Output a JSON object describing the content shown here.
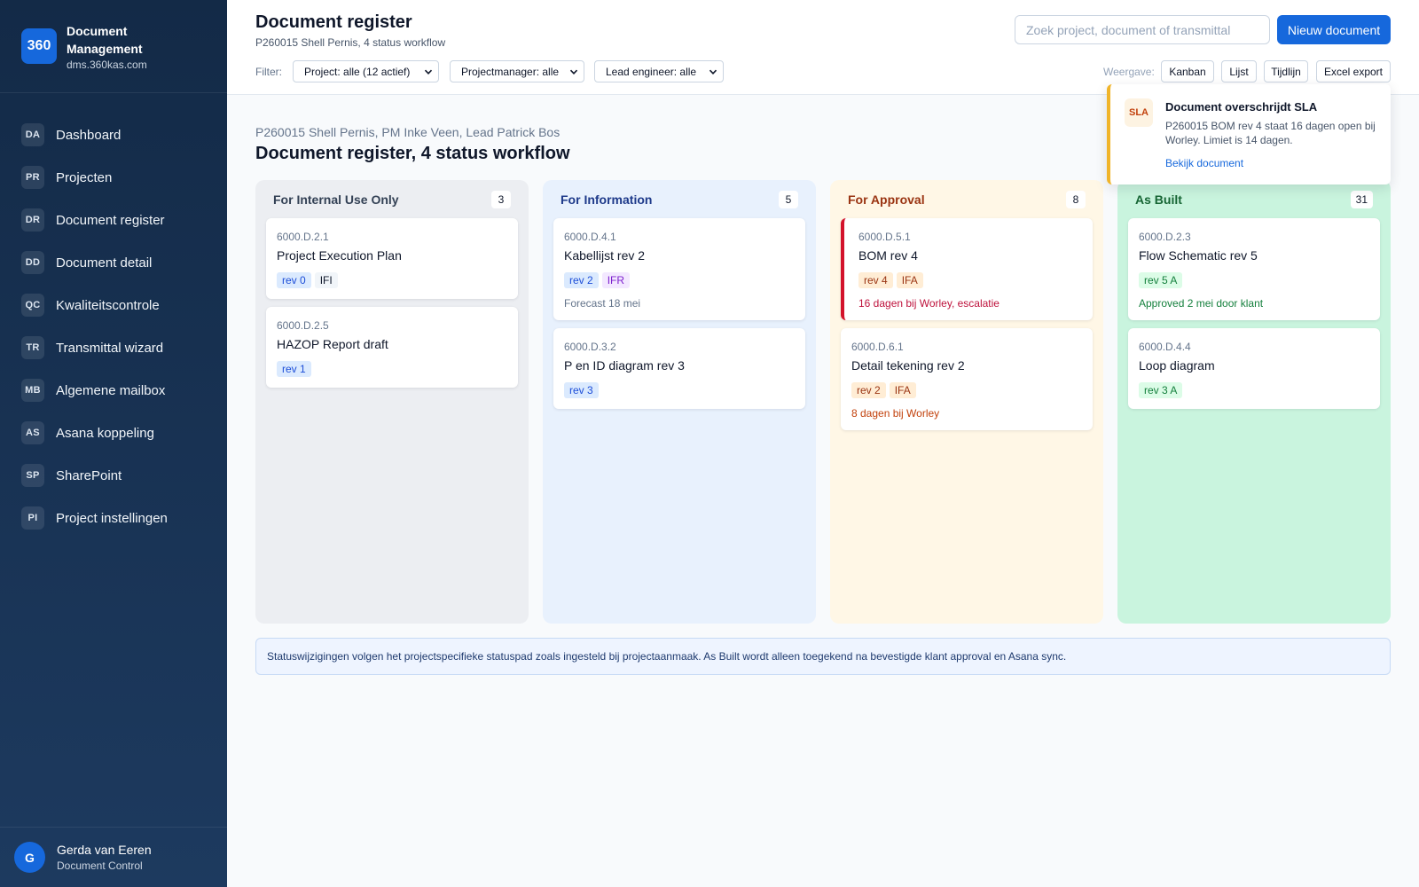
{
  "brand": {
    "logo": "360",
    "name": "Document Management",
    "url": "dms.360kas.com"
  },
  "nav": [
    {
      "abbr": "DA",
      "label": "Dashboard"
    },
    {
      "abbr": "PR",
      "label": "Projecten"
    },
    {
      "abbr": "DR",
      "label": "Document register"
    },
    {
      "abbr": "DD",
      "label": "Document detail"
    },
    {
      "abbr": "QC",
      "label": "Kwaliteitscontrole"
    },
    {
      "abbr": "TR",
      "label": "Transmittal wizard"
    },
    {
      "abbr": "MB",
      "label": "Algemene mailbox"
    },
    {
      "abbr": "AS",
      "label": "Asana koppeling"
    },
    {
      "abbr": "SP",
      "label": "SharePoint"
    },
    {
      "abbr": "PI",
      "label": "Project instellingen"
    }
  ],
  "user": {
    "initial": "G",
    "name": "Gerda van Eeren",
    "role": "Document Control"
  },
  "header": {
    "title": "Document register",
    "subtitle": "P260015 Shell Pernis, 4 status workflow",
    "search_placeholder": "Zoek project, document of transmittal",
    "new_button": "Nieuw document",
    "filter_label": "Filter:",
    "filters": [
      "Project: alle (12 actief)",
      "Projectmanager: alle",
      "Lead engineer: alle"
    ],
    "view_label": "Weergave:",
    "views": [
      "Kanban",
      "Lijst",
      "Tijdlijn",
      "Excel export"
    ]
  },
  "toast": {
    "badge": "SLA",
    "title": "Document overschrijdt SLA",
    "body": "P260015 BOM rev 4 staat 16 dagen open bij Worley. Limiet is 14 dagen.",
    "link": "Bekijk document"
  },
  "content": {
    "crumb": "P260015 Shell Pernis, PM Inke Veen, Lead Patrick Bos",
    "title": "Document register, 4 status workflow"
  },
  "columns": [
    {
      "title": "For Internal Use Only",
      "count": "3",
      "bg": "#eceef2",
      "head_color": "#334155",
      "cards": [
        {
          "code": "6000.D.2.1",
          "title": "Project Execution Plan",
          "tags": [
            {
              "text": "rev 0",
              "kind": "blue"
            },
            {
              "text": "IFI",
              "kind": "gray"
            }
          ],
          "note": ""
        },
        {
          "code": "6000.D.2.5",
          "title": "HAZOP Report draft",
          "tags": [
            {
              "text": "rev 1",
              "kind": "blue"
            }
          ],
          "note": ""
        }
      ]
    },
    {
      "title": "For Information",
      "count": "5",
      "bg": "#e8f1fd",
      "head_color": "#1e3a8a",
      "cards": [
        {
          "code": "6000.D.4.1",
          "title": "Kabellijst rev 2",
          "tags": [
            {
              "text": "rev 2",
              "kind": "blue"
            },
            {
              "text": "IFR",
              "kind": "purple"
            }
          ],
          "note": "Forecast 18 mei",
          "note_color": "#64748b"
        },
        {
          "code": "6000.D.3.2",
          "title": "P en ID diagram rev 3",
          "tags": [
            {
              "text": "rev 3",
              "kind": "blue"
            }
          ],
          "note": ""
        }
      ]
    },
    {
      "title": "For Approval",
      "count": "8",
      "bg": "#fff7e6",
      "head_color": "#9a3412",
      "cards": [
        {
          "code": "6000.D.5.1",
          "title": "BOM rev 4",
          "tags": [
            {
              "text": "rev 4",
              "kind": "orange"
            },
            {
              "text": "IFA",
              "kind": "orange"
            }
          ],
          "note": "16 dagen bij Worley, escalatie",
          "note_color": "#be123c",
          "alert": true
        },
        {
          "code": "6000.D.6.1",
          "title": "Detail tekening rev 2",
          "tags": [
            {
              "text": "rev 2",
              "kind": "orange"
            },
            {
              "text": "IFA",
              "kind": "orange"
            }
          ],
          "note": "8 dagen bij Worley",
          "note_color": "#c2410c"
        }
      ]
    },
    {
      "title": "As Built",
      "count": "31",
      "bg": "#c9f4de",
      "head_color": "#166534",
      "cards": [
        {
          "code": "6000.D.2.3",
          "title": "Flow Schematic rev 5",
          "tags": [
            {
              "text": "rev 5 A",
              "kind": "green"
            }
          ],
          "note": "Approved 2 mei door klant",
          "note_color": "#15803d"
        },
        {
          "code": "6000.D.4.4",
          "title": "Loop diagram",
          "tags": [
            {
              "text": "rev 3 A",
              "kind": "green"
            }
          ],
          "note": ""
        }
      ]
    }
  ],
  "tag_colors": {
    "blue": {
      "bg": "#dbeafe",
      "fg": "#1d4ed8"
    },
    "gray": {
      "bg": "#f1f5f9",
      "fg": "#0f172a"
    },
    "purple": {
      "bg": "#f3e8ff",
      "fg": "#7e22ce"
    },
    "orange": {
      "bg": "#ffedd5",
      "fg": "#9a3412"
    },
    "green": {
      "bg": "#dcfce7",
      "fg": "#15803d"
    }
  },
  "info": "Statuswijzigingen volgen het projectspecifieke statuspad zoals ingesteld bij projectaanmaak. As Built wordt alleen toegekend na bevestigde klant approval en Asana sync."
}
